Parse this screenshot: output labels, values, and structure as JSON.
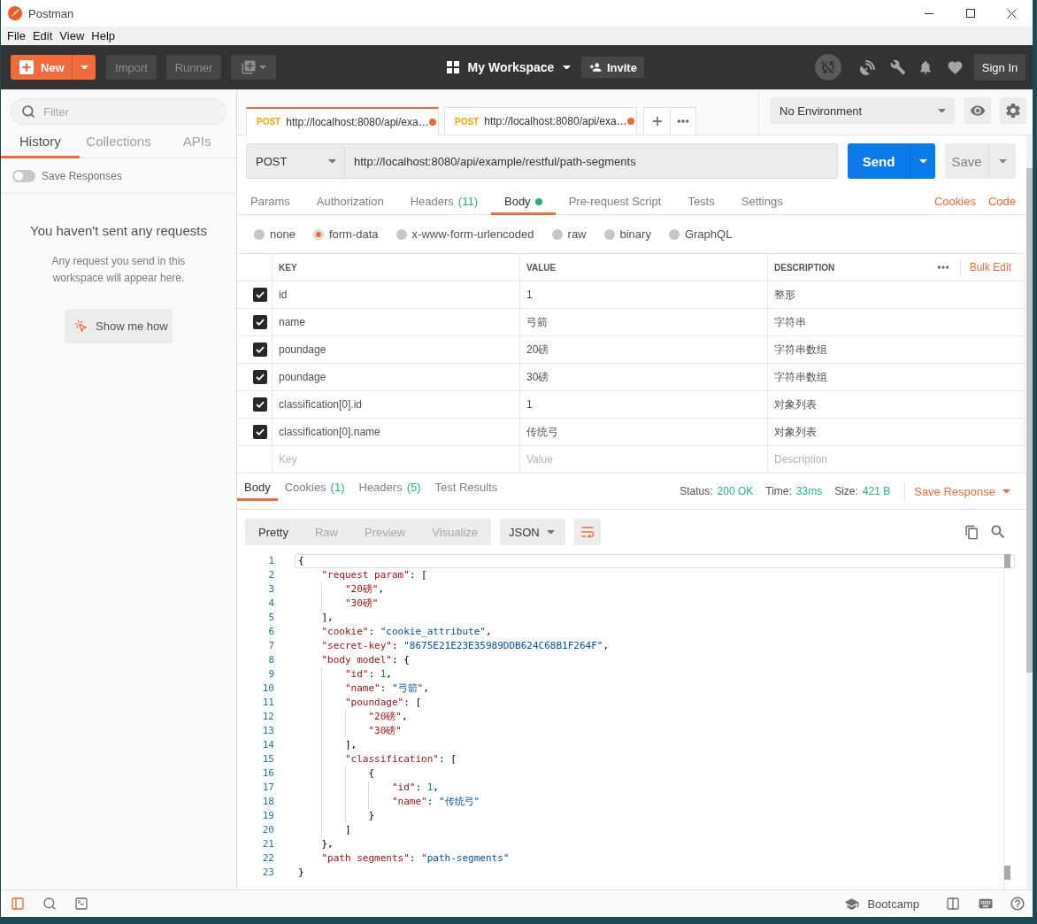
{
  "window": {
    "title": "Postman",
    "menu": [
      "File",
      "Edit",
      "View",
      "Help"
    ]
  },
  "toolbar": {
    "new": "New",
    "import": "Import",
    "runner": "Runner",
    "workspace": "My Workspace",
    "invite": "Invite",
    "sign_in": "Sign In"
  },
  "sidebar": {
    "filter": {
      "placeholder": "Filter"
    },
    "tabs": [
      {
        "label": "History",
        "selected": true
      },
      {
        "label": "Collections",
        "selected": false
      },
      {
        "label": "APIs",
        "selected": false
      }
    ],
    "save_responses": {
      "label": "Save Responses",
      "on": false
    },
    "empty_title": "You haven't sent any requests",
    "empty_text": "Any request you send in this workspace will appear here.",
    "show_me_how": "Show me how"
  },
  "request_tabs": [
    {
      "method": "POST",
      "title": "http://localhost:8080/api/exa…",
      "unsaved": true,
      "selected": true
    },
    {
      "method": "POST",
      "title": "http://localhost:8080/api/exa…",
      "unsaved": true,
      "selected": false
    }
  ],
  "environment": {
    "value": "No Environment"
  },
  "request": {
    "method": "POST",
    "url": "http://localhost:8080/api/example/restful/path-segments",
    "send": "Send",
    "save": "Save"
  },
  "request_sections": [
    {
      "label": "Params",
      "has_content": false,
      "selected": false
    },
    {
      "label": "Authorization",
      "has_content": false,
      "selected": false
    },
    {
      "label": "Headers",
      "count": "(11)",
      "has_content": false,
      "selected": false
    },
    {
      "label": "Body",
      "has_content": true,
      "selected": true
    },
    {
      "label": "Pre-request Script",
      "has_content": false,
      "selected": false
    },
    {
      "label": "Tests",
      "has_content": false,
      "selected": false
    },
    {
      "label": "Settings",
      "has_content": false,
      "selected": false
    }
  ],
  "request_links": [
    "Cookies",
    "Code"
  ],
  "body_types": [
    {
      "label": "none",
      "selected": false
    },
    {
      "label": "form-data",
      "selected": true
    },
    {
      "label": "x-www-form-urlencoded",
      "selected": false
    },
    {
      "label": "raw",
      "selected": false
    },
    {
      "label": "binary",
      "selected": false
    },
    {
      "label": "GraphQL",
      "selected": false
    }
  ],
  "form_data": {
    "columns": [
      "KEY",
      "VALUE",
      "DESCRIPTION"
    ],
    "bulk_edit": "Bulk Edit",
    "rows": [
      {
        "checked": true,
        "key": "id",
        "value": "1",
        "description": "整形"
      },
      {
        "checked": true,
        "key": "name",
        "value": "弓箭",
        "description": "字符串"
      },
      {
        "checked": true,
        "key": "poundage",
        "value": "20磅",
        "description": "字符串数组"
      },
      {
        "checked": true,
        "key": "poundage",
        "value": "30磅",
        "description": "字符串数组"
      },
      {
        "checked": true,
        "key": "classification[0].id",
        "value": "1",
        "description": "对象列表"
      },
      {
        "checked": true,
        "key": "classification[0].name",
        "value": "传统弓",
        "description": "对象列表"
      }
    ],
    "new_row": {
      "key": {
        "placeholder": "Key"
      },
      "value": {
        "placeholder": "Value"
      },
      "description": {
        "placeholder": "Description"
      }
    }
  },
  "response": {
    "tabs": [
      {
        "label": "Body",
        "selected": true
      },
      {
        "label": "Cookies",
        "count": "(1)",
        "selected": false
      },
      {
        "label": "Headers",
        "count": "(5)",
        "selected": false
      },
      {
        "label": "Test Results",
        "selected": false
      }
    ],
    "status": {
      "label": "Status:",
      "value": "200 OK"
    },
    "time": {
      "label": "Time:",
      "value": "33ms"
    },
    "size": {
      "label": "Size:",
      "value": "421 B"
    },
    "save_response": "Save Response",
    "views": [
      {
        "label": "Pretty",
        "selected": true
      },
      {
        "label": "Raw",
        "selected": false
      },
      {
        "label": "Preview",
        "selected": false
      },
      {
        "label": "Visualize",
        "selected": false
      }
    ],
    "format": "JSON",
    "wrap": {
      "on": true
    },
    "code_lines": [
      {
        "number": "1",
        "active": true,
        "tokens": [
          {
            "kind": "punct",
            "text": "{"
          }
        ]
      },
      {
        "number": "2",
        "active": false,
        "tokens": [
          {
            "kind": "variable",
            "text": "    \"request param\""
          },
          {
            "kind": "punct",
            "text": ": ["
          }
        ]
      },
      {
        "number": "3",
        "active": false,
        "tokens": [
          {
            "kind": "variable",
            "text": "        \"20磅\""
          },
          {
            "kind": "punct",
            "text": ","
          }
        ]
      },
      {
        "number": "4",
        "active": false,
        "tokens": [
          {
            "kind": "variable",
            "text": "        \"30磅\""
          }
        ]
      },
      {
        "number": "5",
        "active": false,
        "tokens": [
          {
            "kind": "punct",
            "text": "    ],"
          }
        ]
      },
      {
        "number": "6",
        "active": false,
        "tokens": [
          {
            "kind": "variable",
            "text": "    \"cookie\""
          },
          {
            "kind": "punct",
            "text": ": "
          },
          {
            "kind": "string",
            "text": "\"cookie_attribute\""
          },
          {
            "kind": "punct",
            "text": ","
          }
        ]
      },
      {
        "number": "7",
        "active": false,
        "tokens": [
          {
            "kind": "variable",
            "text": "    \"secret-key\""
          },
          {
            "kind": "punct",
            "text": ": "
          },
          {
            "kind": "string",
            "text": "\"8675E21E23E35989DDB624C68B1F264F\""
          },
          {
            "kind": "punct",
            "text": ","
          }
        ]
      },
      {
        "number": "8",
        "active": false,
        "tokens": [
          {
            "kind": "variable",
            "text": "    \"body model\""
          },
          {
            "kind": "punct",
            "text": ": {"
          }
        ]
      },
      {
        "number": "9",
        "active": false,
        "tokens": [
          {
            "kind": "variable",
            "text": "        \"id\""
          },
          {
            "kind": "punct",
            "text": ": "
          },
          {
            "kind": "number",
            "text": "1"
          },
          {
            "kind": "punct",
            "text": ","
          }
        ]
      },
      {
        "number": "10",
        "active": false,
        "tokens": [
          {
            "kind": "variable",
            "text": "        \"name\""
          },
          {
            "kind": "punct",
            "text": ": "
          },
          {
            "kind": "string",
            "text": "\"弓箭\""
          },
          {
            "kind": "punct",
            "text": ","
          }
        ]
      },
      {
        "number": "11",
        "active": false,
        "tokens": [
          {
            "kind": "variable",
            "text": "        \"poundage\""
          },
          {
            "kind": "punct",
            "text": ": ["
          }
        ]
      },
      {
        "number": "12",
        "active": false,
        "tokens": [
          {
            "kind": "variable",
            "text": "            \"20磅\""
          },
          {
            "kind": "punct",
            "text": ","
          }
        ]
      },
      {
        "number": "13",
        "active": false,
        "tokens": [
          {
            "kind": "variable",
            "text": "            \"30磅\""
          }
        ]
      },
      {
        "number": "14",
        "active": false,
        "tokens": [
          {
            "kind": "punct",
            "text": "        ],"
          }
        ]
      },
      {
        "number": "15",
        "active": false,
        "tokens": [
          {
            "kind": "variable",
            "text": "        \"classification\""
          },
          {
            "kind": "punct",
            "text": ": ["
          }
        ]
      },
      {
        "number": "16",
        "active": false,
        "tokens": [
          {
            "kind": "punct",
            "text": "            {"
          }
        ]
      },
      {
        "number": "17",
        "active": false,
        "tokens": [
          {
            "kind": "variable",
            "text": "                \"id\""
          },
          {
            "kind": "punct",
            "text": ": "
          },
          {
            "kind": "number",
            "text": "1"
          },
          {
            "kind": "punct",
            "text": ","
          }
        ]
      },
      {
        "number": "18",
        "active": false,
        "tokens": [
          {
            "kind": "variable",
            "text": "                \"name\""
          },
          {
            "kind": "punct",
            "text": ": "
          },
          {
            "kind": "string",
            "text": "\"传统弓\""
          }
        ]
      },
      {
        "number": "19",
        "active": false,
        "tokens": [
          {
            "kind": "punct",
            "text": "            }"
          }
        ]
      },
      {
        "number": "20",
        "active": false,
        "tokens": [
          {
            "kind": "punct",
            "text": "        ]"
          }
        ]
      },
      {
        "number": "21",
        "active": false,
        "tokens": [
          {
            "kind": "punct",
            "text": "    },"
          }
        ]
      },
      {
        "number": "22",
        "active": false,
        "tokens": [
          {
            "kind": "variable",
            "text": "    \"path segments\""
          },
          {
            "kind": "punct",
            "text": ": "
          },
          {
            "kind": "string",
            "text": "\"path-segments\""
          }
        ]
      },
      {
        "number": "23",
        "active": false,
        "tokens": [
          {
            "kind": "punct",
            "text": "}"
          }
        ]
      }
    ]
  },
  "status_bar": {
    "sidebar_toggle": {
      "on": true
    },
    "bootcamp": "Bootcamp"
  }
}
